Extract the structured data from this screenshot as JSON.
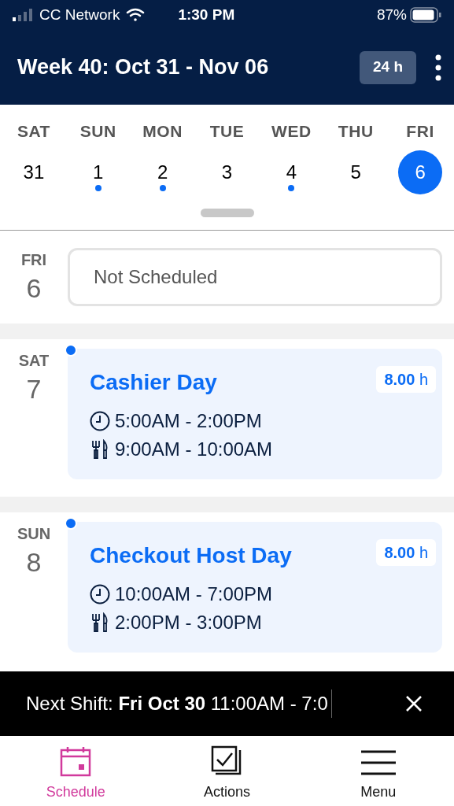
{
  "status_bar": {
    "carrier": "CC Network",
    "time": "1:30 PM",
    "battery": "87%"
  },
  "header": {
    "title": "Week 40: Oct 31 - Nov 06",
    "hours_toggle": "24 h"
  },
  "week": [
    {
      "weekday": "SAT",
      "date": "31",
      "has_shift": false,
      "selected": false
    },
    {
      "weekday": "SUN",
      "date": "1",
      "has_shift": true,
      "selected": false
    },
    {
      "weekday": "MON",
      "date": "2",
      "has_shift": true,
      "selected": false
    },
    {
      "weekday": "TUE",
      "date": "3",
      "has_shift": false,
      "selected": false
    },
    {
      "weekday": "WED",
      "date": "4",
      "has_shift": true,
      "selected": false
    },
    {
      "weekday": "THU",
      "date": "5",
      "has_shift": false,
      "selected": false
    },
    {
      "weekday": "FRI",
      "date": "6",
      "has_shift": false,
      "selected": true
    }
  ],
  "days": [
    {
      "weekday": "FRI",
      "date": "6",
      "kind": "empty",
      "label": "Not Scheduled"
    },
    {
      "weekday": "SAT",
      "date": "7",
      "kind": "shift",
      "unread": true,
      "title": "Cashier Day",
      "hours": "8.00",
      "unit": "h",
      "time": "5:00AM - 2:00PM",
      "meal": "9:00AM - 10:00AM"
    },
    {
      "weekday": "SUN",
      "date": "8",
      "kind": "shift",
      "unread": true,
      "title": "Checkout Host Day",
      "hours": "8.00",
      "unit": "h",
      "time": "10:00AM - 7:00PM",
      "meal": "2:00PM - 3:00PM"
    }
  ],
  "banner": {
    "text": "Next Shift: **Fri Oct 30** 11:00AM - 7:0"
  },
  "tabs": [
    {
      "label": "Schedule",
      "selected": true
    },
    {
      "label": "Actions",
      "selected": false
    },
    {
      "label": "Menu",
      "selected": false
    }
  ]
}
